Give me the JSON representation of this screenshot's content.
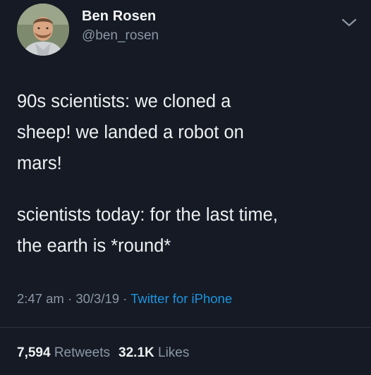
{
  "author": {
    "display_name": "Ben Rosen",
    "handle": "@ben_rosen"
  },
  "tweet": {
    "paragraph_1": "90s scientists: we cloned a\nsheep! we landed a robot on\nmars!",
    "paragraph_2": "scientists today: for the last time,\nthe earth is *round*"
  },
  "meta": {
    "time": "2:47 am",
    "separator_1": " · ",
    "date": "30/3/19",
    "separator_2": " · ",
    "source": "Twitter for iPhone"
  },
  "stats": {
    "retweets_count": "7,594",
    "retweets_label": " Retweets",
    "likes_count": "32.1K",
    "likes_label": " Likes"
  },
  "icons": {
    "menu": "chevron-down-icon"
  },
  "colors": {
    "background": "#151a24",
    "text_primary": "#eef0f3",
    "text_secondary": "#8b97a6",
    "link": "#1b95e0",
    "divider": "#2b3340"
  }
}
